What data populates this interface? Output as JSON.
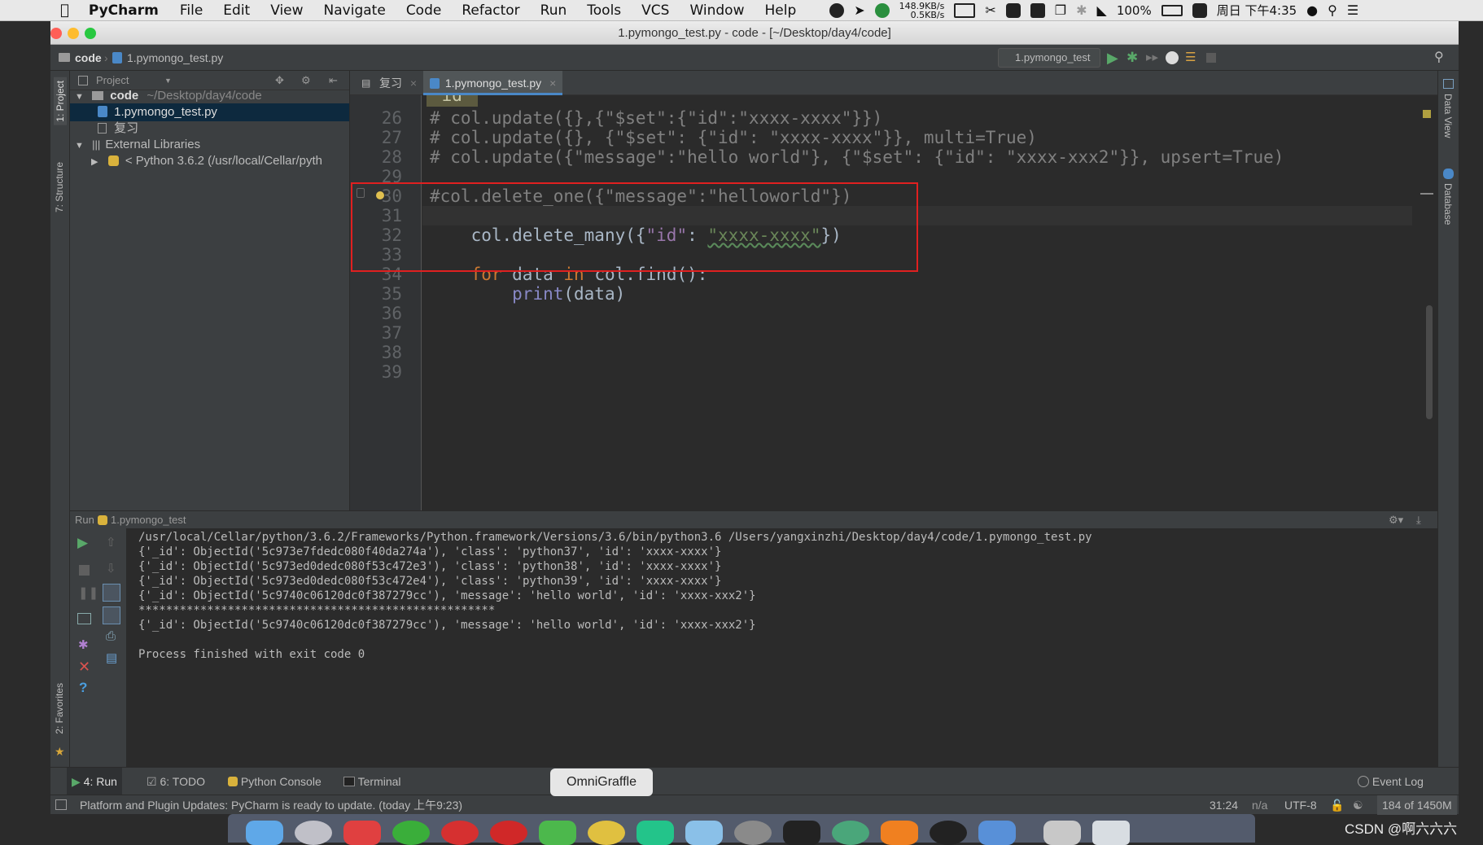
{
  "menubar": {
    "app": "PyCharm",
    "items": [
      "File",
      "Edit",
      "View",
      "Navigate",
      "Code",
      "Refactor",
      "Run",
      "Tools",
      "VCS",
      "Window",
      "Help"
    ],
    "net_up": "148.9KB/s",
    "net_down": "0.5KB/s",
    "battery": "100%",
    "clock": "周日 下午4:35"
  },
  "window": {
    "title": "1.pymongo_test.py - code - [~/Desktop/day4/code]"
  },
  "navbar": {
    "crumb_root": "code",
    "crumb_file": "1.pymongo_test.py",
    "run_config": "1.pymongo_test"
  },
  "sidebar": {
    "project_tab": "1: Project",
    "structure_tab": "7: Structure",
    "favorites_tab": "2: Favorites",
    "data_view_tab": "Data View",
    "database_tab": "Database"
  },
  "project": {
    "header": "Project",
    "root_name": "code",
    "root_path": "~/Desktop/day4/code",
    "file1": "1.pymongo_test.py",
    "file2": "复习",
    "ext_libs": "External Libraries",
    "python": "< Python 3.6.2 (/usr/local/Cellar/pyth"
  },
  "editor": {
    "tabs": [
      {
        "label": "复习"
      },
      {
        "label": "1.pymongo_test.py"
      }
    ],
    "breadcrumb": "\"id\"",
    "line_numbers": [
      "26",
      "27",
      "28",
      "29",
      "30",
      "31",
      "32",
      "33",
      "34",
      "35",
      "36",
      "37",
      "38",
      "39"
    ]
  },
  "code": {
    "l26": "# col.update({},{\"$set\":{\"id\":\"xxxx-xxxx\"}})",
    "l27": "# col.update({}, {\"$set\": {\"id\": \"xxxx-xxxx\"}}, multi=True)",
    "l28": "# col.update({\"message\":\"hello world\"}, {\"$set\": {\"id\": \"xxxx-xxx2\"}}, upsert=True)",
    "l30": "#col.delete_one({\"message\":\"helloworld\"})",
    "l31_a": "col.delete_many({",
    "l31_key": "\"id\"",
    "l31_colon": ": ",
    "l31_val": "\"xxxx-xxxx\"",
    "l31_end": "})",
    "l33_kw1": "for",
    "l33_a": " data ",
    "l33_kw2": "in",
    "l33_b": " col.find():",
    "l34_indent": "    ",
    "l34_fn": "print",
    "l34_rest": "(data)"
  },
  "run": {
    "header_label": "Run",
    "config": "1.pymongo_test",
    "lines": [
      "/usr/local/Cellar/python/3.6.2/Frameworks/Python.framework/Versions/3.6/bin/python3.6 /Users/yangxinzhi/Desktop/day4/code/1.pymongo_test.py",
      "{'_id': ObjectId('5c973e7fdedc080f40da274a'), 'class': 'python37', 'id': 'xxxx-xxxx'}",
      "{'_id': ObjectId('5c973ed0dedc080f53c472e3'), 'class': 'python38', 'id': 'xxxx-xxxx'}",
      "{'_id': ObjectId('5c973ed0dedc080f53c472e4'), 'class': 'python39', 'id': 'xxxx-xxxx'}",
      "{'_id': ObjectId('5c9740c06120dc0f387279cc'), 'message': 'hello world', 'id': 'xxxx-xxx2'}",
      "****************************************************",
      "{'_id': ObjectId('5c9740c06120dc0f387279cc'), 'message': 'hello world', 'id': 'xxxx-xxx2'}",
      "",
      "Process finished with exit code 0"
    ]
  },
  "bottom_tabs": {
    "run": "4: Run",
    "todo": "6: TODO",
    "python_console": "Python Console",
    "terminal": "Terminal",
    "event_log": "Event Log"
  },
  "status": {
    "message": "Platform and Plugin Updates: PyCharm is ready to update. (today 上午9:23)",
    "position": "31:24",
    "na": "n/a",
    "encoding": "UTF-8",
    "memory": "184 of 1450M"
  },
  "tooltip": "OmniGraffle",
  "watermark": "CSDN @啊六六六",
  "colors": {
    "editor_bg": "#2b2b2b",
    "panel_bg": "#3c3f41",
    "keyword": "#cc7832",
    "string": "#6a8759",
    "comment": "#808080",
    "highlight_box": "#e02020"
  }
}
